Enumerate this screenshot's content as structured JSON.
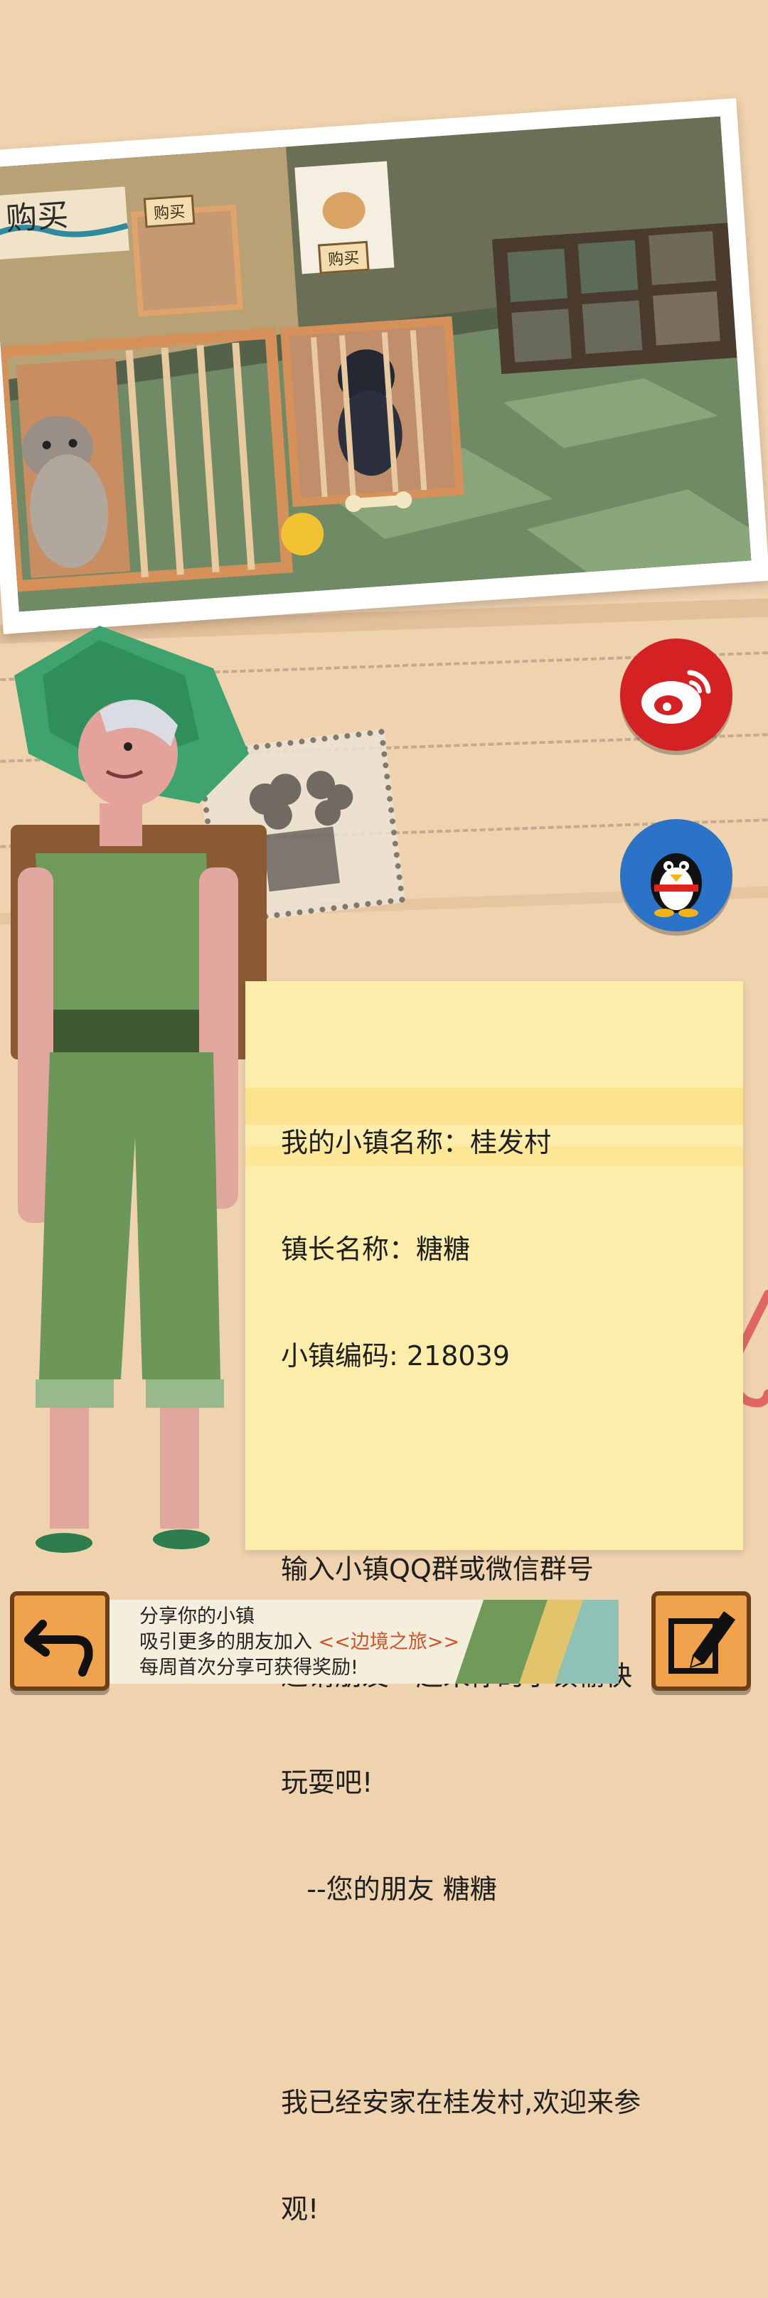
{
  "photo": {
    "sign_big": "购买",
    "sign_small_cage": "购买",
    "sign_dog_poster": "购买"
  },
  "social": {
    "weibo_icon": "weibo-icon",
    "qq_icon": "qq-penguin-icon"
  },
  "note": {
    "line1": "我的小镇名称：桂发村",
    "line2": "镇长名称：糖糖",
    "line3": "小镇编码: 218039",
    "line4": "输入小镇QQ群或微信群号",
    "line5": "邀请朋友一起来你的小镇愉快",
    "line6": "玩耍吧!",
    "line7": "   --您的朋友 糖糖",
    "line8": "我已经安家在桂发村,欢迎来参",
    "line9": "观!"
  },
  "bottom": {
    "share_line1": "分享你的小镇",
    "share_line2_prefix": "吸引更多的朋友加入 ",
    "share_line2_highlight": "<<边境之旅>>",
    "share_line3": "每周首次分享可获得奖励!",
    "back_icon": "back-arrow-icon",
    "edit_icon": "edit-pencil-icon"
  },
  "colors": {
    "background": "#efd2ae",
    "weibo_red": "#d32124",
    "qq_blue": "#2a73c8",
    "note_yellow": "#fdedaa",
    "button_orange": "#f0a34c",
    "highlight_text": "#c9552a"
  }
}
